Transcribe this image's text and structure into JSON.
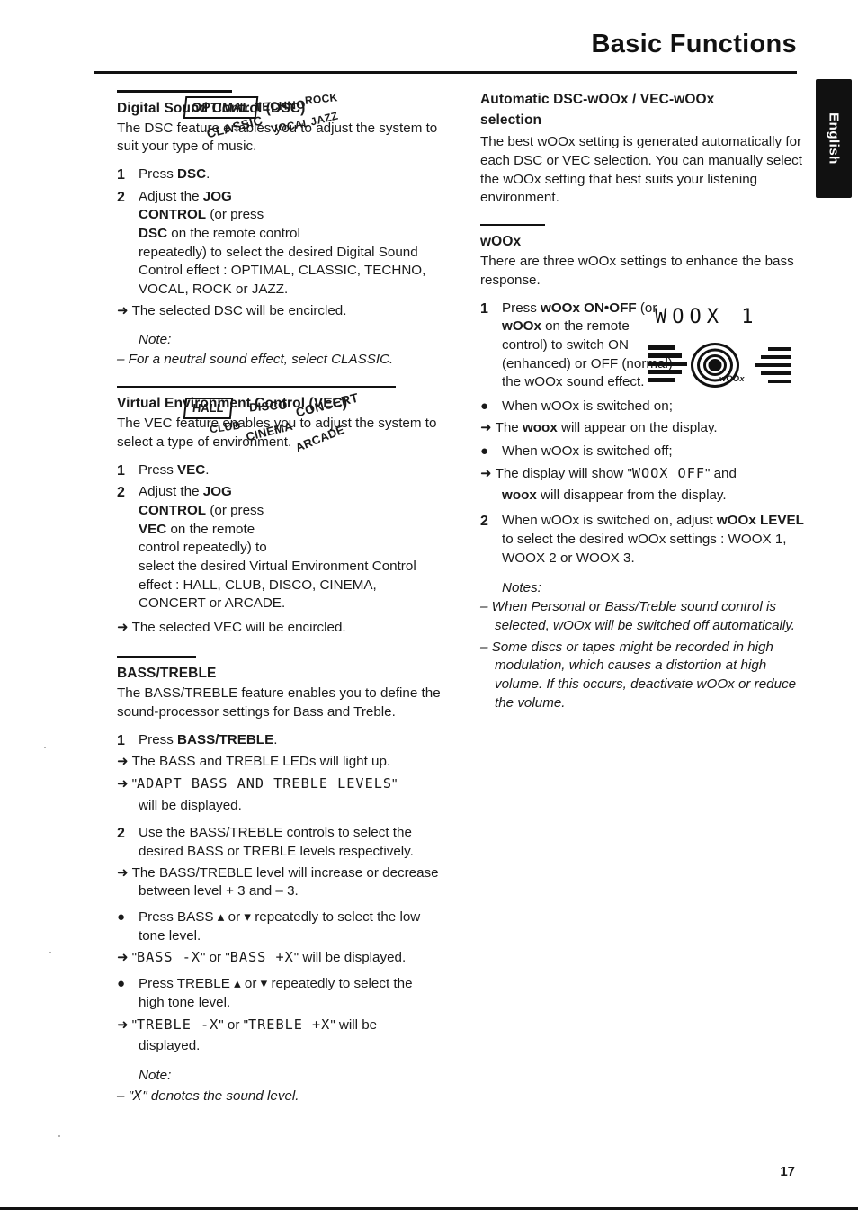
{
  "header": {
    "title": "Basic Functions",
    "side_tab": "English"
  },
  "page_number": "17",
  "left_column": {
    "dsc": {
      "heading": "Digital Sound Control (DSC)",
      "intro": "The DSC feature enables you to adjust the system to suit your type of music.",
      "step1_num": "1",
      "step1_text": "Press DSC.",
      "step1_bold": "DSC",
      "step2_num": "2",
      "step2_lines": [
        "Adjust the JOG",
        "CONTROL (or press",
        "DSC on the remote control",
        "repeatedly) to select the desired Digital Sound",
        "Control effect : OPTIMAL, CLASSIC, TECHNO,",
        "VOCAL, ROCK or JAZZ."
      ],
      "arrow_result": "The selected DSC will be encircled.",
      "note_heading": "Note:",
      "note_text": "– For a neutral sound effect, select CLASSIC.",
      "sticker": {
        "optimal": "OPTIMAL",
        "techno": "TECHNO",
        "rock": "ROCK",
        "vocal": "VOCAL",
        "jazz": "JAZZ",
        "classic": "CLASSIC"
      }
    },
    "vec": {
      "heading": "Virtual Environment Control (VEC)",
      "intro": "The VEC feature enables you to adjust the system to select a type of environment.",
      "step1_num": "1",
      "step1_text": "Press VEC.",
      "step2_num": "2",
      "step2_lines": [
        "Adjust the JOG",
        "CONTROL (or press",
        "VEC on the remote",
        "control repeatedly) to",
        "select the desired Virtual Environment Control",
        "effect : HALL, CLUB, DISCO, CINEMA,",
        "CONCERT or ARCADE."
      ],
      "arrow_result": "The selected VEC will be encircled.",
      "sticker": {
        "hall": "HALL",
        "disco": "DISCO",
        "concert": "CONCERT",
        "club": "CLUB",
        "cinema": "CINEMA",
        "arcade": "ARCADE"
      }
    },
    "bass_treble": {
      "heading": "BASS/TREBLE",
      "intro": "The BASS/TREBLE feature enables you to define the sound-processor settings for Bass and Treble.",
      "step1_num": "1",
      "step1_text": "Press BASS/TREBLE.",
      "step1_arrow1": "The BASS and TREBLE LEDs will light up.",
      "step1_arrow2_pre": "\"",
      "step1_arrow2_lcd": "ADAPT BASS AND TREBLE LEVELS",
      "step1_arrow2_post": "\"",
      "step1_arrow2_cont": "will be displayed.",
      "step2_num": "2",
      "step2_text": "Use the BASS/TREBLE controls to select the desired BASS or TREBLE levels respectively.",
      "step2_arrow": "The BASS/TREBLE level will increase or decrease between level + 3 and – 3.",
      "bullet1": "Press BASS ▴ or ▾ repeatedly to select the low tone level.",
      "bullet1_arrow_a": "BASS -X",
      "bullet1_arrow_b": "BASS +X",
      "bullet1_arrow_tail": "will be displayed.",
      "bullet2": "Press TREBLE ▴ or ▾ repeatedly to select the high tone level.",
      "bullet2_arrow_a": "TREBLE -X",
      "bullet2_arrow_b": "TREBLE +X",
      "bullet2_arrow_tail": "will be displayed.",
      "note_heading": "Note:",
      "note_text_pre": "– \"",
      "note_text_lcd": "X",
      "note_text_post": "\" denotes the sound level."
    }
  },
  "right_column": {
    "auto_dsc": {
      "heading_line1": "Automatic DSC-wOOx / VEC-wOOx",
      "heading_line2": "selection",
      "body": "The best wOOx setting is generated automatically for each DSC or VEC selection. You can manually select the wOOx setting that best suits your listening environment."
    },
    "woox": {
      "heading": "wOOx",
      "intro": "There are three wOOx settings to enhance the bass response.",
      "step1_num": "1",
      "step1_lines": [
        "Press wOOx ON•OFF (or",
        "wOOx on the remote",
        "control) to switch ON",
        "(enhanced) or OFF (normal)",
        "the wOOx sound effect."
      ],
      "bullet1": "When wOOx is switched on;",
      "bullet1_arrow": "The woox will appear on the display.",
      "bullet2": "When wOOx is switched off;",
      "bullet2_arrow_pre": "The display will show \"",
      "bullet2_arrow_lcd": "WOOX OFF",
      "bullet2_arrow_post": "\" and",
      "bullet2_arrow_cont": "woox will disappear from the display.",
      "step2_num": "2",
      "step2_text": "When wOOx is switched on, adjust wOOx LEVEL to select the desired wOOx settings : WOOX 1, WOOX 2 or WOOX 3.",
      "notes_heading": "Notes:",
      "note1": "– When Personal or Bass/Treble sound control is selected, wOOx will be switched off automatically.",
      "note2": "– Some discs or tapes might be recorded in high modulation, which causes a distortion at high volume. If this occurs, deactivate wOOx or reduce the volume.",
      "display_art_text": "WOOX 1",
      "display_art_label": "wOOx"
    }
  }
}
